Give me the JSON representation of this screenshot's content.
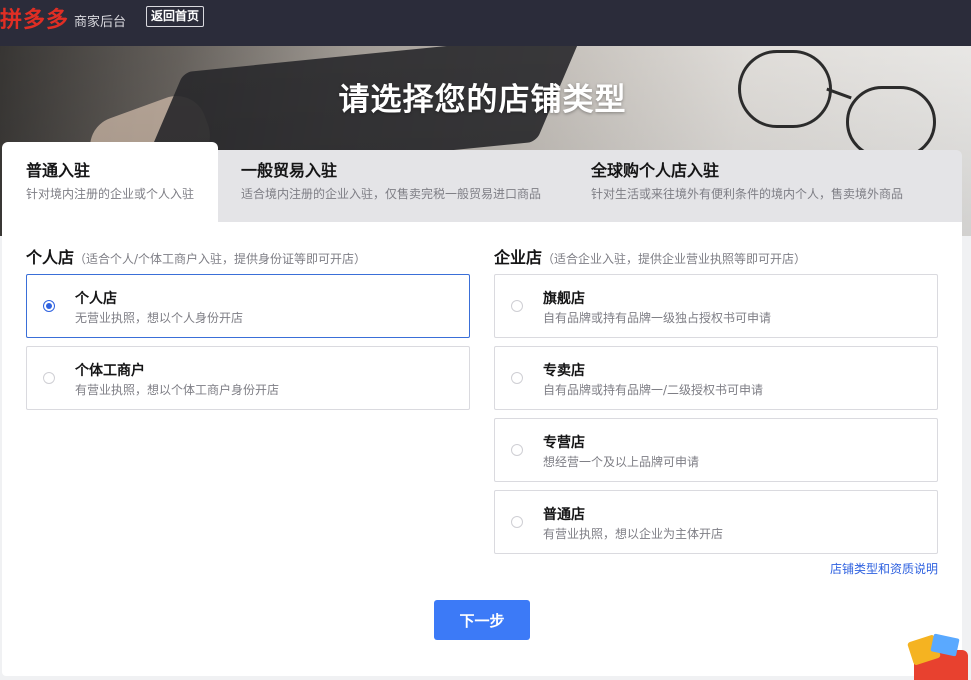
{
  "header": {
    "logo_text": "拼多多",
    "subtitle": "商家后台",
    "back_button": "返回首页"
  },
  "banner": {
    "title": "请选择您的店铺类型"
  },
  "tabs": [
    {
      "title": "普通入驻",
      "desc": "针对境内注册的企业或个人入驻",
      "active": true
    },
    {
      "title": "一般贸易入驻",
      "desc": "适合境内注册的企业入驻，仅售卖完税一般贸易进口商品",
      "active": false
    },
    {
      "title": "全球购个人店入驻",
      "desc": "针对生活或来往境外有便利条件的境内个人，售卖境外商品",
      "active": false
    }
  ],
  "personal": {
    "title": "个人店",
    "hint": "（适合个人/个体工商户入驻，提供身份证等即可开店）",
    "options": [
      {
        "name": "个人店",
        "desc": "无营业执照，想以个人身份开店",
        "selected": true
      },
      {
        "name": "个体工商户",
        "desc": "有营业执照，想以个体工商户身份开店",
        "selected": false
      }
    ]
  },
  "company": {
    "title": "企业店",
    "hint": "（适合企业入驻，提供企业营业执照等即可开店）",
    "options": [
      {
        "name": "旗舰店",
        "desc": "自有品牌或持有品牌一级独占授权书可申请",
        "selected": false
      },
      {
        "name": "专卖店",
        "desc": "自有品牌或持有品牌一/二级授权书可申请",
        "selected": false
      },
      {
        "name": "专营店",
        "desc": "想经营一个及以上品牌可申请",
        "selected": false
      },
      {
        "name": "普通店",
        "desc": "有营业执照，想以企业为主体开店",
        "selected": false
      }
    ]
  },
  "help_link": "店铺类型和资质说明",
  "next_button": "下一步",
  "colors": {
    "brand_red": "#e02e24",
    "primary_blue": "#3c7af7",
    "link_blue": "#2f62e0",
    "topbar_bg": "#2b2c3a"
  },
  "icons": {
    "floating_gift": "gift-icon"
  }
}
